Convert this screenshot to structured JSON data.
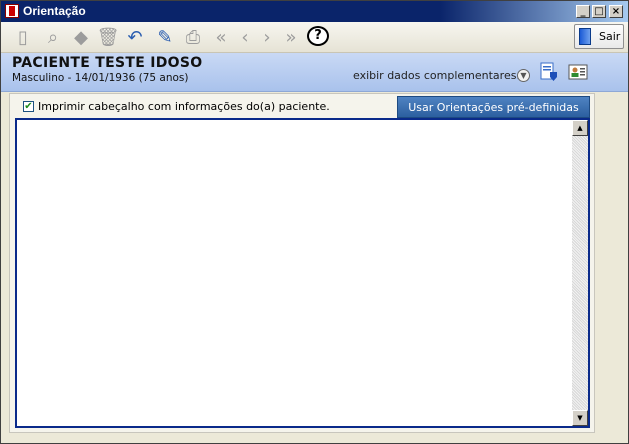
{
  "window": {
    "title": "Orientação",
    "controls": [
      "_",
      "□",
      "×"
    ]
  },
  "toolbar": {
    "items": [
      {
        "icon": "new-icon",
        "glyph": "▯",
        "enabled": false
      },
      {
        "icon": "binoculars-icon",
        "glyph": "⌕",
        "enabled": false
      },
      {
        "icon": "eraser-icon",
        "glyph": "◆",
        "enabled": false
      },
      {
        "icon": "trash-icon",
        "glyph": "🗑",
        "enabled": false
      },
      {
        "icon": "undo-icon",
        "glyph": "↶",
        "enabled": true
      },
      {
        "icon": "edit-icon",
        "glyph": "✎",
        "enabled": true
      },
      {
        "icon": "print-icon",
        "glyph": "⎙",
        "enabled": false
      },
      {
        "icon": "first-icon",
        "glyph": "«",
        "enabled": false
      },
      {
        "icon": "prev-icon",
        "glyph": "‹",
        "enabled": false
      },
      {
        "icon": "next-icon",
        "glyph": "›",
        "enabled": false
      },
      {
        "icon": "last-icon",
        "glyph": "»",
        "enabled": false
      }
    ],
    "help_label": "?",
    "exit_label": "Sair"
  },
  "patient": {
    "name": "PACIENTE TESTE IDOSO",
    "info": "Masculino - 14/01/1936 (75 anos)",
    "extra_label": "exibir dados complementares..."
  },
  "form": {
    "print_header_label": "Imprimir cabeçalho com informações do(a) paciente.",
    "print_header_checked": true,
    "predefined_button": "Usar Orientações pré-definidas",
    "text_value": ""
  }
}
